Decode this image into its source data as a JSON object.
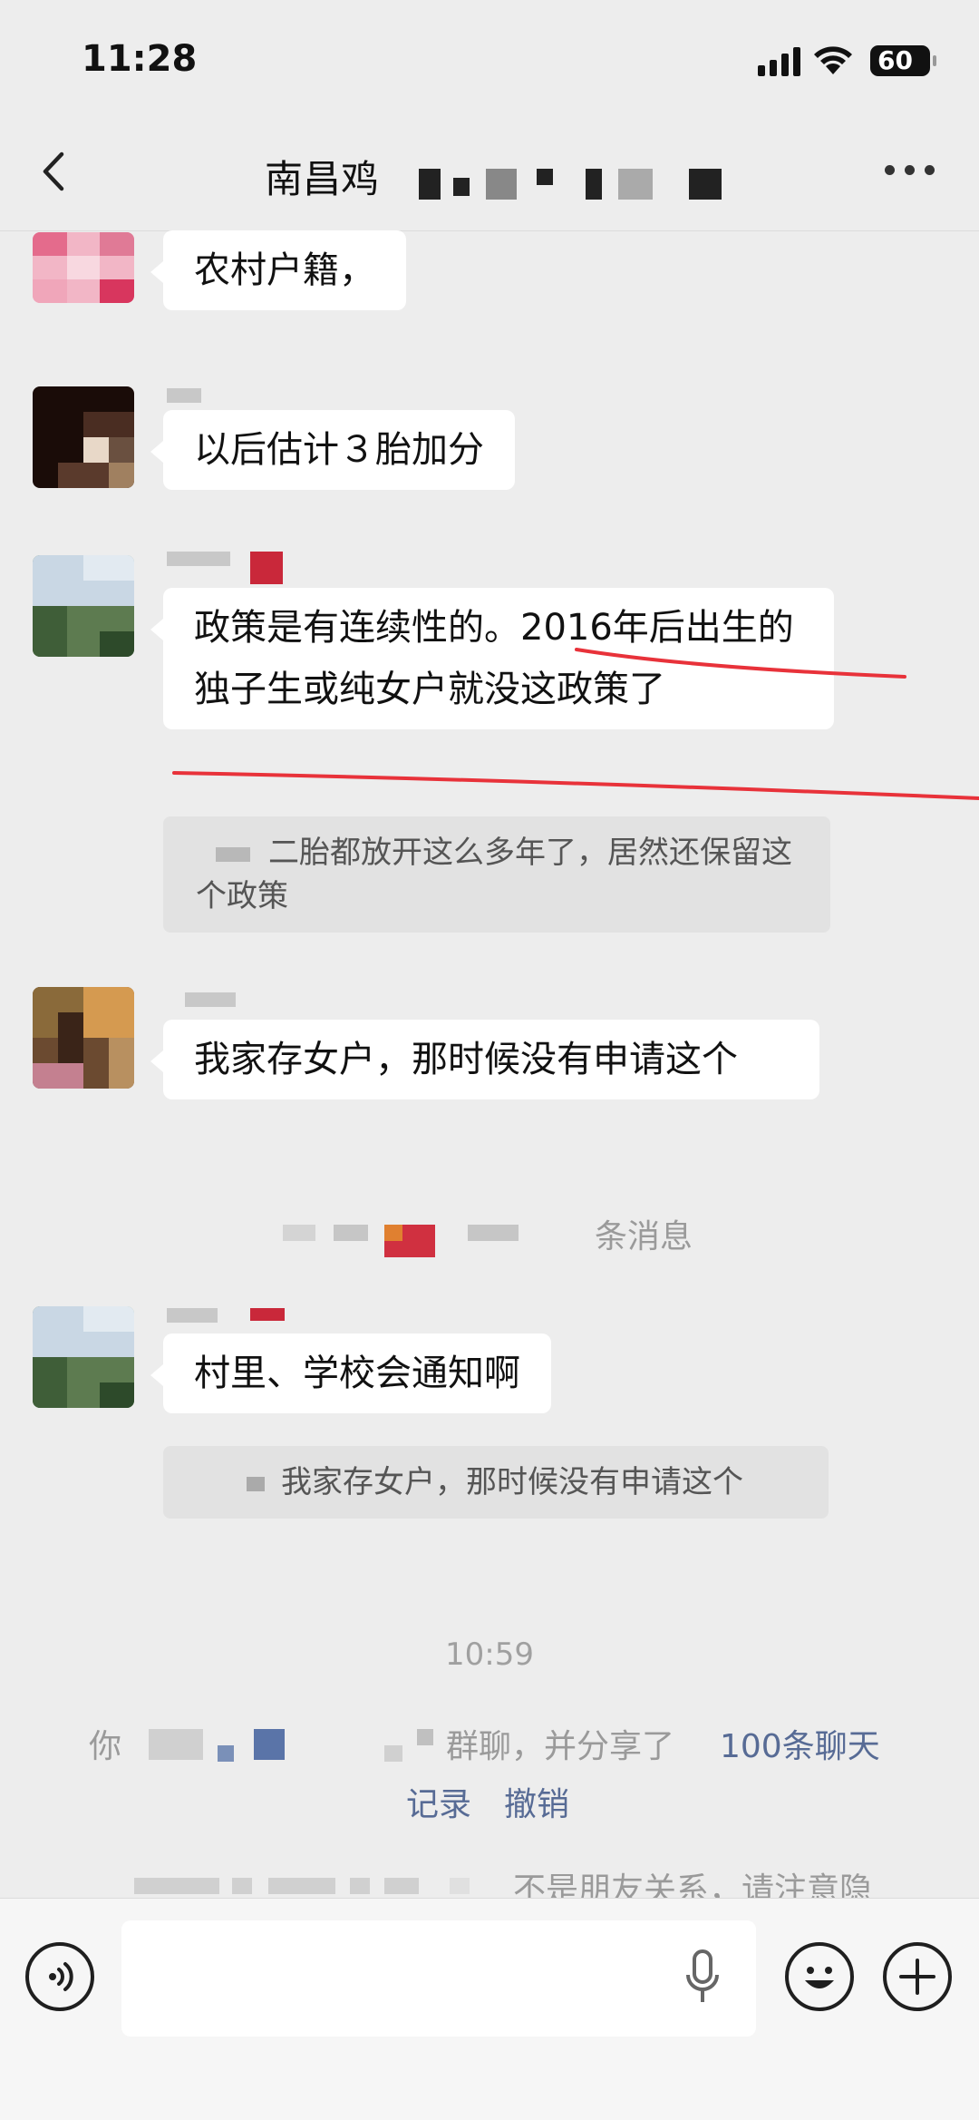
{
  "status_bar": {
    "time": "11:28",
    "battery": "60"
  },
  "header": {
    "title_visible": "南昌鸡"
  },
  "messages": [
    {
      "text": "农村户籍，"
    },
    {
      "text": "以后估计３胎加分"
    },
    {
      "text": "政策是有连续性的。2016年后出生的独子生或纯女户就没这政策了"
    },
    {
      "quote": "二胎都放开这么多年了，居然还保留这个政策"
    },
    {
      "text": "我家存女户，那时候没有申请这个"
    },
    {
      "text": "村里、学校会通知啊"
    },
    {
      "quote": "我家存女户，那时候没有申请这个"
    }
  ],
  "collapsed_notice": "条消息",
  "timestamp": "10:59",
  "system": {
    "invite_prefix": "你",
    "invite_suffix": "群聊，并分享了",
    "invite_link": "100条聊天",
    "record_link": "记录",
    "undo_link": "撤销",
    "privacy_notice": "不是朋友关系，请注意隐"
  },
  "input_bar": {
    "icons": [
      "voice-mode-icon",
      "microphone-icon",
      "emoji-icon",
      "plus-icon"
    ]
  }
}
